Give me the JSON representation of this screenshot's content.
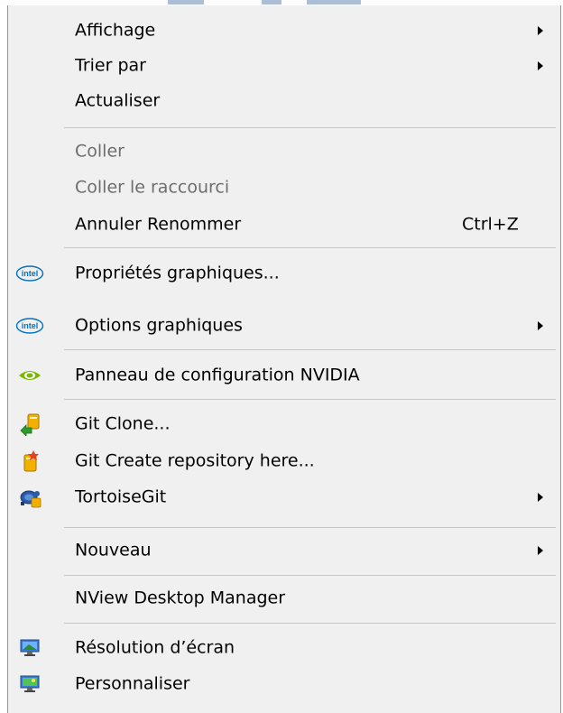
{
  "menu": {
    "items": [
      {
        "key": "affichage",
        "label": "Affichage",
        "submenu": true
      },
      {
        "key": "trier",
        "label": "Trier par",
        "submenu": true
      },
      {
        "key": "actualiser",
        "label": "Actualiser"
      },
      {
        "key": "coller",
        "label": "Coller",
        "disabled": true
      },
      {
        "key": "coller-raccourci",
        "label": "Coller le raccourci",
        "disabled": true
      },
      {
        "key": "annuler",
        "label": "Annuler Renommer",
        "shortcut": "Ctrl+Z"
      },
      {
        "key": "proprietes-graphiques",
        "label": "Propriétés graphiques...",
        "icon": "intel-logo-icon"
      },
      {
        "key": "options-graphiques",
        "label": "Options graphiques",
        "icon": "intel-logo-icon",
        "submenu": true
      },
      {
        "key": "nvidia",
        "label": "Panneau de configuration NVIDIA",
        "icon": "nvidia-eye-icon"
      },
      {
        "key": "git-clone",
        "label": "Git Clone...",
        "icon": "git-clone-icon"
      },
      {
        "key": "git-create",
        "label": "Git Create repository here...",
        "icon": "git-create-repo-icon"
      },
      {
        "key": "tortoisegit",
        "label": "TortoiseGit",
        "icon": "tortoisegit-icon",
        "submenu": true
      },
      {
        "key": "nouveau",
        "label": "Nouveau",
        "submenu": true
      },
      {
        "key": "nview",
        "label": "NView Desktop Manager"
      },
      {
        "key": "resolution",
        "label": "Résolution d’écran",
        "icon": "screen-resolution-icon"
      },
      {
        "key": "personnaliser",
        "label": "Personnaliser",
        "icon": "personalize-icon"
      }
    ],
    "intel_text": "intel"
  },
  "colors": {
    "menu_background": "#f0f0f0",
    "disabled_text": "#6d6d6d",
    "separator": "#c6c6c6",
    "intel_blue": "#0071c5",
    "nvidia_green": "#76b900"
  }
}
